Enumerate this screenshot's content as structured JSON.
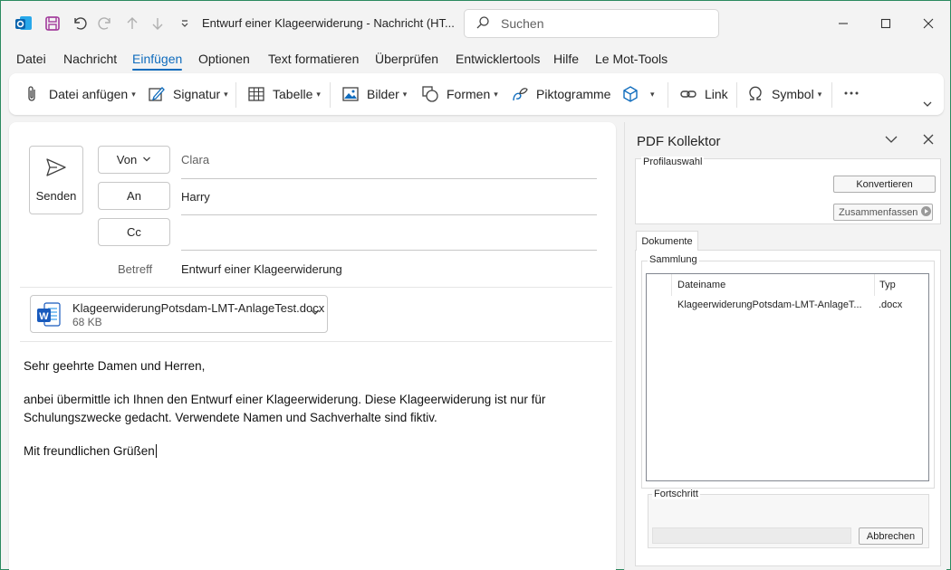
{
  "titlebar": {
    "title": "Entwurf einer Klageerwiderung  -  Nachricht (HT...",
    "search_placeholder": "Suchen"
  },
  "menu": {
    "tabs": [
      "Datei",
      "Nachricht",
      "Einfügen",
      "Optionen",
      "Text formatieren",
      "Überprüfen",
      "Entwicklertools",
      "Hilfe",
      "Le Mot-Tools"
    ],
    "active": "Einfügen"
  },
  "ribbon": {
    "attach_label": "Datei anfügen",
    "signature_label": "Signatur",
    "table_label": "Tabelle",
    "pictures_label": "Bilder",
    "shapes_label": "Formen",
    "icons_label": "Piktogramme",
    "link_label": "Link",
    "symbol_label": "Symbol"
  },
  "compose": {
    "send_label": "Senden",
    "from_label": "Von",
    "from_value": "Clara",
    "to_label": "An",
    "to_value": "Harry",
    "cc_label": "Cc",
    "cc_value": "",
    "subject_label": "Betreff",
    "subject_value": "Entwurf einer Klageerwiderung",
    "attachment": {
      "name": "KlageerwiderungPotsdam-LMT-AnlageTest.docx",
      "size": "68 KB"
    },
    "body": {
      "greeting": "Sehr geehrte Damen und Herren,",
      "line1": "anbei übermittle ich Ihnen den Entwurf einer Klageerwiderung. Diese Klageerwiderung ist nur für",
      "line2": "Schulungszwecke gedacht. Verwendete Namen und Sachverhalte sind fiktiv.",
      "closing": "Mit freundlichen Grüßen"
    }
  },
  "pdf_panel": {
    "title": "PDF Kollektor",
    "profile_group": "Profilauswahl",
    "convert_button": "Konvertieren",
    "merge_button": "Zusammenfassen",
    "documents_tab": "Dokumente",
    "collection_group": "Sammlung",
    "columns": {
      "filename": "Dateiname",
      "type": "Typ"
    },
    "rows": [
      {
        "filename": "KlageerwiderungPotsdam-LMT-AnlageT...",
        "type": ".docx"
      }
    ],
    "progress_group": "Fortschritt",
    "cancel_button": "Abbrechen"
  },
  "colors": {
    "accent": "#0f6cbd",
    "word_blue": "#185abd",
    "save_purple": "#a23b9c"
  }
}
